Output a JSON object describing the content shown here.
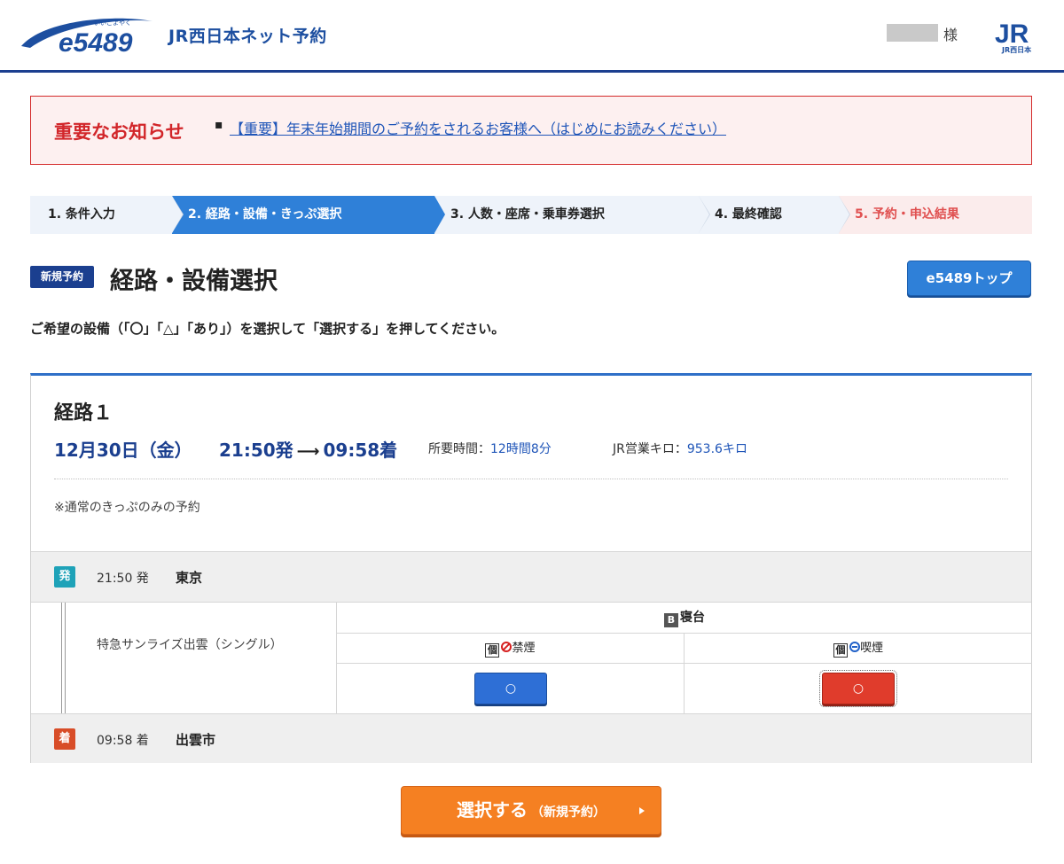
{
  "header": {
    "logo_text": "e5489",
    "logo_ruby": "いいごよやく",
    "site_name": "JR西日本ネット予約",
    "user_suffix": "様",
    "jr_logo_text": "JR",
    "jr_logo_sub": "JR西日本"
  },
  "notice": {
    "title": "重要なお知らせ",
    "bullet": "▪",
    "link": "【重要】年末年始期間のご予約をされるお客様へ（はじめにお読みください）"
  },
  "steps": [
    {
      "label": "1. 条件入力"
    },
    {
      "label": "2. 経路・設備・きっぷ選択"
    },
    {
      "label": "3. 人数・座席・乗車券選択"
    },
    {
      "label": "4. 最終確認"
    },
    {
      "label": "5. 予約・申込結果"
    }
  ],
  "page": {
    "badge": "新規予約",
    "title": "経路・設備選択",
    "top_button": "e5489トップ",
    "instruction": "ご希望の設備（「〇」「△」「あり」）を選択して「選択する」を押してください。"
  },
  "route": {
    "title": "経路１",
    "date": "12月30日（金）",
    "depart_time": "21:50発",
    "arrow": "⟶",
    "arrive_time": "09:58着",
    "duration_label": "所要時間：",
    "duration_value": "12時間8分",
    "distance_label": "JR営業キロ：",
    "distance_value": "953.6キロ",
    "note": "※通常のきっぷのみの予約",
    "departure": {
      "tag": "発",
      "time": "21:50 発",
      "station": "東京"
    },
    "arrival": {
      "tag": "着",
      "time": "09:58 着",
      "station": "出雲市"
    },
    "train": {
      "name": "特急サンライズ出雲（シングル）",
      "facility_icon": "B",
      "facility": "寝台",
      "columns": [
        {
          "ko": "個",
          "label": "禁煙",
          "button": "○",
          "selected": false,
          "color": "#2e6fd6"
        },
        {
          "ko": "個",
          "label": "喫煙",
          "button": "○",
          "selected": true,
          "color": "#e03c2c"
        }
      ]
    }
  },
  "submit": {
    "main": "選択する",
    "sub": "（新規予約）"
  }
}
